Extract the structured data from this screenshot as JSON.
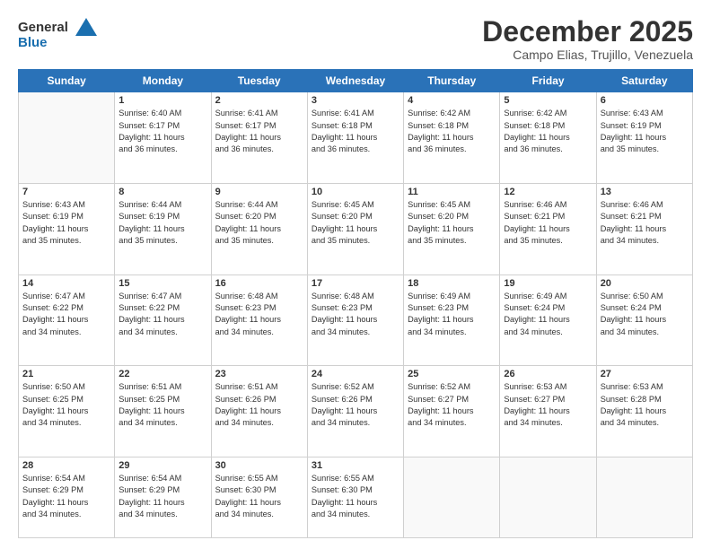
{
  "header": {
    "logo_general": "General",
    "logo_blue": "Blue",
    "month_title": "December 2025",
    "location": "Campo Elias, Trujillo, Venezuela"
  },
  "days_of_week": [
    "Sunday",
    "Monday",
    "Tuesday",
    "Wednesday",
    "Thursday",
    "Friday",
    "Saturday"
  ],
  "weeks": [
    [
      {
        "day": "",
        "info": ""
      },
      {
        "day": "1",
        "info": "Sunrise: 6:40 AM\nSunset: 6:17 PM\nDaylight: 11 hours\nand 36 minutes."
      },
      {
        "day": "2",
        "info": "Sunrise: 6:41 AM\nSunset: 6:17 PM\nDaylight: 11 hours\nand 36 minutes."
      },
      {
        "day": "3",
        "info": "Sunrise: 6:41 AM\nSunset: 6:18 PM\nDaylight: 11 hours\nand 36 minutes."
      },
      {
        "day": "4",
        "info": "Sunrise: 6:42 AM\nSunset: 6:18 PM\nDaylight: 11 hours\nand 36 minutes."
      },
      {
        "day": "5",
        "info": "Sunrise: 6:42 AM\nSunset: 6:18 PM\nDaylight: 11 hours\nand 36 minutes."
      },
      {
        "day": "6",
        "info": "Sunrise: 6:43 AM\nSunset: 6:19 PM\nDaylight: 11 hours\nand 35 minutes."
      }
    ],
    [
      {
        "day": "7",
        "info": "Sunrise: 6:43 AM\nSunset: 6:19 PM\nDaylight: 11 hours\nand 35 minutes."
      },
      {
        "day": "8",
        "info": "Sunrise: 6:44 AM\nSunset: 6:19 PM\nDaylight: 11 hours\nand 35 minutes."
      },
      {
        "day": "9",
        "info": "Sunrise: 6:44 AM\nSunset: 6:20 PM\nDaylight: 11 hours\nand 35 minutes."
      },
      {
        "day": "10",
        "info": "Sunrise: 6:45 AM\nSunset: 6:20 PM\nDaylight: 11 hours\nand 35 minutes."
      },
      {
        "day": "11",
        "info": "Sunrise: 6:45 AM\nSunset: 6:20 PM\nDaylight: 11 hours\nand 35 minutes."
      },
      {
        "day": "12",
        "info": "Sunrise: 6:46 AM\nSunset: 6:21 PM\nDaylight: 11 hours\nand 35 minutes."
      },
      {
        "day": "13",
        "info": "Sunrise: 6:46 AM\nSunset: 6:21 PM\nDaylight: 11 hours\nand 34 minutes."
      }
    ],
    [
      {
        "day": "14",
        "info": "Sunrise: 6:47 AM\nSunset: 6:22 PM\nDaylight: 11 hours\nand 34 minutes."
      },
      {
        "day": "15",
        "info": "Sunrise: 6:47 AM\nSunset: 6:22 PM\nDaylight: 11 hours\nand 34 minutes."
      },
      {
        "day": "16",
        "info": "Sunrise: 6:48 AM\nSunset: 6:23 PM\nDaylight: 11 hours\nand 34 minutes."
      },
      {
        "day": "17",
        "info": "Sunrise: 6:48 AM\nSunset: 6:23 PM\nDaylight: 11 hours\nand 34 minutes."
      },
      {
        "day": "18",
        "info": "Sunrise: 6:49 AM\nSunset: 6:23 PM\nDaylight: 11 hours\nand 34 minutes."
      },
      {
        "day": "19",
        "info": "Sunrise: 6:49 AM\nSunset: 6:24 PM\nDaylight: 11 hours\nand 34 minutes."
      },
      {
        "day": "20",
        "info": "Sunrise: 6:50 AM\nSunset: 6:24 PM\nDaylight: 11 hours\nand 34 minutes."
      }
    ],
    [
      {
        "day": "21",
        "info": "Sunrise: 6:50 AM\nSunset: 6:25 PM\nDaylight: 11 hours\nand 34 minutes."
      },
      {
        "day": "22",
        "info": "Sunrise: 6:51 AM\nSunset: 6:25 PM\nDaylight: 11 hours\nand 34 minutes."
      },
      {
        "day": "23",
        "info": "Sunrise: 6:51 AM\nSunset: 6:26 PM\nDaylight: 11 hours\nand 34 minutes."
      },
      {
        "day": "24",
        "info": "Sunrise: 6:52 AM\nSunset: 6:26 PM\nDaylight: 11 hours\nand 34 minutes."
      },
      {
        "day": "25",
        "info": "Sunrise: 6:52 AM\nSunset: 6:27 PM\nDaylight: 11 hours\nand 34 minutes."
      },
      {
        "day": "26",
        "info": "Sunrise: 6:53 AM\nSunset: 6:27 PM\nDaylight: 11 hours\nand 34 minutes."
      },
      {
        "day": "27",
        "info": "Sunrise: 6:53 AM\nSunset: 6:28 PM\nDaylight: 11 hours\nand 34 minutes."
      }
    ],
    [
      {
        "day": "28",
        "info": "Sunrise: 6:54 AM\nSunset: 6:29 PM\nDaylight: 11 hours\nand 34 minutes."
      },
      {
        "day": "29",
        "info": "Sunrise: 6:54 AM\nSunset: 6:29 PM\nDaylight: 11 hours\nand 34 minutes."
      },
      {
        "day": "30",
        "info": "Sunrise: 6:55 AM\nSunset: 6:30 PM\nDaylight: 11 hours\nand 34 minutes."
      },
      {
        "day": "31",
        "info": "Sunrise: 6:55 AM\nSunset: 6:30 PM\nDaylight: 11 hours\nand 34 minutes."
      },
      {
        "day": "",
        "info": ""
      },
      {
        "day": "",
        "info": ""
      },
      {
        "day": "",
        "info": ""
      }
    ]
  ]
}
